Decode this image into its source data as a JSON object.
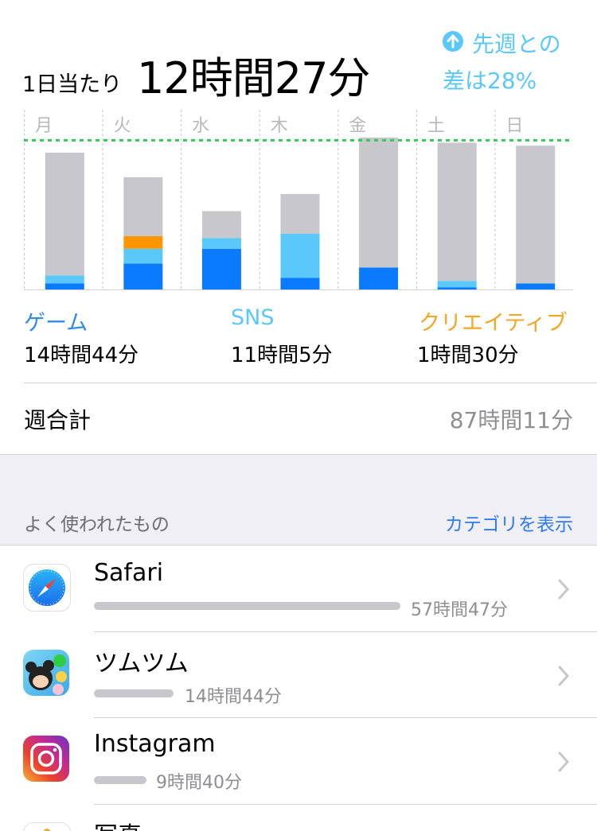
{
  "header": {
    "avg_label": "1日当たり",
    "avg_value": "12時間27分",
    "trend_line1": "先週との",
    "trend_line2": "差は28%",
    "trend_icon": "arrow-up-circle-icon"
  },
  "chart_data": {
    "type": "bar",
    "categories": [
      "月",
      "火",
      "水",
      "木",
      "金",
      "土",
      "日"
    ],
    "unit": "minutes",
    "series": [
      {
        "name": "ゲーム",
        "color": "#0A7AFF",
        "values": [
          30,
          130,
          203,
          58,
          110,
          10,
          30
        ]
      },
      {
        "name": "SNS",
        "color": "#5AC8FA",
        "values": [
          40,
          74,
          54,
          221,
          0,
          33,
          0
        ]
      },
      {
        "name": "クリエイティブ",
        "color": "#FF9500",
        "values": [
          0,
          63,
          0,
          0,
          0,
          0,
          0
        ]
      },
      {
        "name": "other",
        "color": "#C7C7CC",
        "values": [
          615,
          295,
          135,
          199,
          651,
          692,
          690
        ]
      }
    ],
    "average_line_minutes": 747,
    "ylim": [
      0,
      900
    ],
    "grid": "vertical dotted day separators",
    "average_line_color": "#34C759"
  },
  "legend": [
    {
      "name": "ゲーム",
      "time": "14時間44分",
      "color": "#2F8BE8"
    },
    {
      "name": "SNS",
      "time": "11時間5分",
      "color": "#5AC8FA"
    },
    {
      "name": "クリエイティブ",
      "time": "1時間30分",
      "color": "#F5A623"
    }
  ],
  "weekly": {
    "label": "週合計",
    "value": "87時間11分"
  },
  "section": {
    "label": "よく使われたもの",
    "link": "カテゴリを表示"
  },
  "apps": [
    {
      "name": "Safari",
      "time": "57時間47分",
      "icon": "safari-compass-icon",
      "minutes": 3467
    },
    {
      "name": "ツムツム",
      "time": "14時間44分",
      "icon": "tsum-tsum-app-icon",
      "minutes": 884
    },
    {
      "name": "Instagram",
      "time": "9時間40分",
      "icon": "instagram-camera-icon",
      "minutes": 580
    },
    {
      "name": "写真",
      "time": "",
      "icon": "photos-flower-icon",
      "minutes": 0
    }
  ]
}
